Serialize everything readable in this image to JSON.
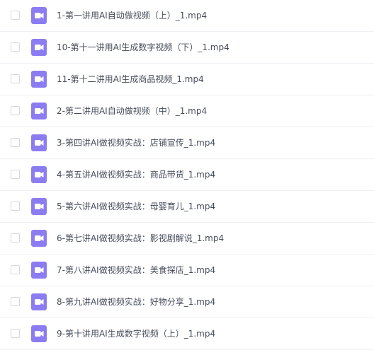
{
  "files": [
    {
      "name": "1-第一讲用AI自动做视频（上）_1.mp4",
      "icon": "video-file-icon"
    },
    {
      "name": "10-第十一讲用AI生成数字视频（下）_1.mp4",
      "icon": "video-file-icon"
    },
    {
      "name": "11-第十二讲用AI生成商品视频_1.mp4",
      "icon": "video-file-icon"
    },
    {
      "name": "2-第二讲用AI自动做视频（中）_1.mp4",
      "icon": "video-file-icon"
    },
    {
      "name": "3-第四讲AI做视频实战：店铺宣传_1.mp4",
      "icon": "video-file-icon"
    },
    {
      "name": "4-第五讲AI做视频实战：商品带货_1.mp4",
      "icon": "video-file-icon"
    },
    {
      "name": "5-第六讲AI做视频实战：母婴育儿_1.mp4",
      "icon": "video-file-icon"
    },
    {
      "name": "6-第七讲AI做视频实战：影视剧解说_1.mp4",
      "icon": "video-file-icon"
    },
    {
      "name": "7-第八讲AI做视频实战：美食探店_1.mp4",
      "icon": "video-file-icon"
    },
    {
      "name": "8-第九讲AI做视频实战：好物分享_1.mp4",
      "icon": "video-file-icon"
    },
    {
      "name": "9-第十讲用AI生成数字视频（上）_1.mp4",
      "icon": "video-file-icon"
    }
  ],
  "colors": {
    "icon_bg": "#8b7cf2",
    "text": "#454d5a",
    "divider": "#eef0f4",
    "checkbox_border": "#d4d7de"
  }
}
